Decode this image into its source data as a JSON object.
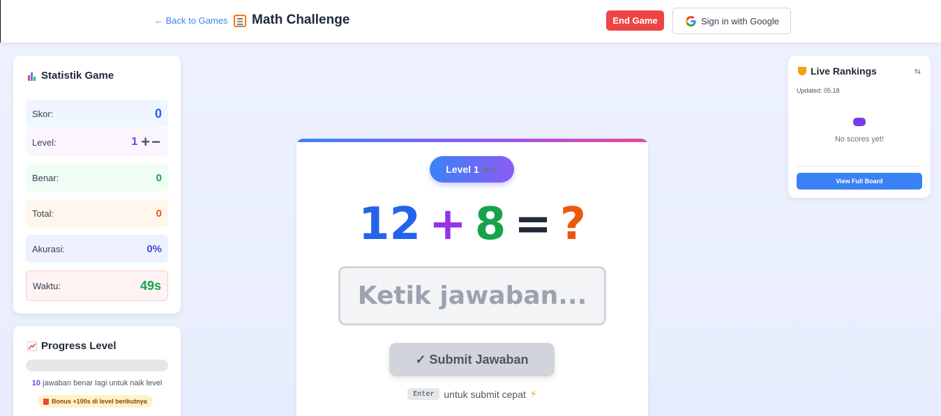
{
  "header": {
    "back_label": "← Back to Games",
    "app_title": "Math Challenge",
    "end_game_label": "End Game",
    "sign_in_label": "Sign in with Google"
  },
  "stats": {
    "title": "Statistik Game",
    "rows": [
      {
        "label": "Skor:",
        "value": "0",
        "color": "#2563eb",
        "bg": "#eff6ff"
      },
      {
        "label": "Level:",
        "value": "1",
        "color": "#7c3aed",
        "bg": "#faf5ff",
        "suffix": "+−"
      },
      {
        "label": "Benar:",
        "value": "0",
        "color": "#16a34a",
        "bg": "#f0fdf4"
      },
      {
        "label": "Total:",
        "value": "0",
        "color": "#ea580c",
        "bg": "#fff7ed"
      },
      {
        "label": "Akurasi:",
        "value": "0%",
        "color": "#4f46e5",
        "bg": "#eef2ff"
      },
      {
        "label": "Waktu:",
        "value": "49s",
        "color": "#16a34a",
        "bg": "#fef2f2"
      }
    ]
  },
  "progress": {
    "title": "Progress Level",
    "fraction": 0,
    "remaining": "10",
    "note_text": " jawaban benar lagi untuk naik level",
    "bonus": "Bonus +100s di level berikutnya"
  },
  "game": {
    "level_pill": "Level 1",
    "level_pm": "+−",
    "operand1": "12",
    "operator": "+",
    "operand2": "8",
    "equals": "=",
    "unknown": "?",
    "input_placeholder": "Ketik jawaban...",
    "input_value": "",
    "submit_label": "✓ Submit Jawaban",
    "hint_key": "Enter",
    "hint_text": "untuk submit cepat",
    "colors": {
      "operand1": "#2563eb",
      "operator": "#9333ea",
      "operand2": "#16a34a",
      "equals": "#1f2937",
      "unknown": "#ea580c"
    }
  },
  "rankings": {
    "title": "Live Rankings",
    "toggle": "⇆",
    "updated": "Updated: 05.18",
    "empty": "No scores yet!",
    "view_label": "View Full Board"
  }
}
